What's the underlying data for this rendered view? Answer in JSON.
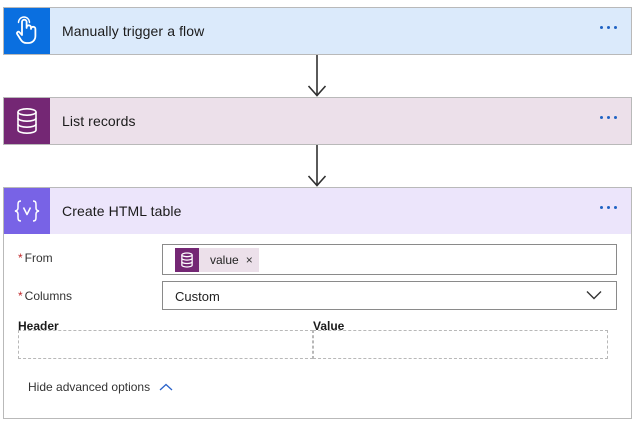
{
  "steps": {
    "trigger": {
      "title": "Manually trigger a flow",
      "icon": "touch-hand-icon",
      "accent": "#0a6fe0"
    },
    "list": {
      "title": "List records",
      "icon": "database-icon",
      "accent": "#742774"
    },
    "html_table": {
      "title": "Create HTML table",
      "icon": "curly-braces-icon",
      "accent": "#7863e6",
      "fields": {
        "from": {
          "label": "From",
          "required_mark": "*",
          "token": {
            "text": "value",
            "remove": "×",
            "icon": "database-icon"
          }
        },
        "columns": {
          "label": "Columns",
          "required_mark": "*",
          "selected": "Custom"
        }
      },
      "table": {
        "header_label": "Header",
        "value_label": "Value"
      },
      "advanced": {
        "label": "Hide advanced options"
      }
    }
  }
}
